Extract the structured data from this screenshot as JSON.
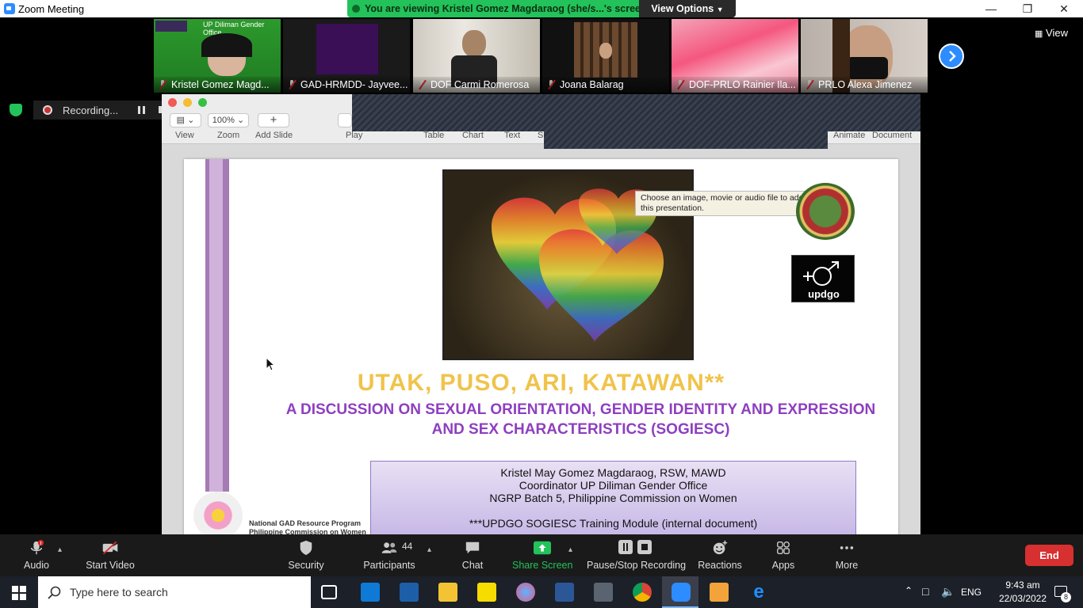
{
  "window": {
    "title": "Zoom Meeting"
  },
  "banner": {
    "viewing_text": "You are viewing Kristel Gomez Magdaraog (she/s...'s screen",
    "view_options": "View Options"
  },
  "participants": [
    {
      "name": "Kristel Gomez Magd..."
    },
    {
      "name": "GAD-HRMDD- Jayvee..."
    },
    {
      "name": "DOF Carmi Romerosa"
    },
    {
      "name": "Joana Balarag"
    },
    {
      "name": "DOF-PRLO Rainier Ila..."
    },
    {
      "name": "PRLO Alexa Jimenez"
    }
  ],
  "gallery": {
    "view_label": "View",
    "tile1_caption": "UP Diliman Gender Office"
  },
  "recording": {
    "label": "Recording..."
  },
  "keynote": {
    "zoom_value": "100%",
    "labels": [
      "View",
      "Zoom",
      "Add Slide",
      "Play",
      "Table",
      "Chart",
      "Text",
      "S",
      "Animate",
      "Document"
    ]
  },
  "slide": {
    "tooltip": "Choose an image, movie or audio file to add to this presentation.",
    "title": "UTAK, PUSO, ARI, KATAWAN**",
    "subtitle_line1": "A DISCUSSION ON SEXUAL ORIENTATION, GENDER IDENTITY AND EXPRESSION",
    "subtitle_line2": "AND SEX CHARACTERISTICS (SOGIESC)",
    "credits": [
      "Kristel May Gomez Magdaraog, RSW,  MAWD",
      "Coordinator  UP  Diliman  Gender  Office",
      "NGRP Batch 5, Philippine Commission on Women",
      "***UPDGO SOGIESC Training Module (internal document)"
    ],
    "updgo_logo_text": "updgo",
    "ngrp_line1": "National GAD Resource Program",
    "ngrp_line2": "Philippine Commission on Women"
  },
  "controls": {
    "audio": "Audio",
    "start_video": "Start Video",
    "security": "Security",
    "participants": "Participants",
    "participants_count": "44",
    "chat": "Chat",
    "share_screen": "Share Screen",
    "pause_stop_recording": "Pause/Stop Recording",
    "reactions": "Reactions",
    "apps": "Apps",
    "more": "More",
    "end": "End"
  },
  "taskbar": {
    "search_placeholder": "Type here to search",
    "language": "ENG",
    "time": "9:43 am",
    "date": "22/03/2022",
    "notifications": "8"
  },
  "colors": {
    "zoom_blue": "#2d8cff",
    "banner_green": "#23c25a",
    "end_red": "#d73030",
    "slide_title": "#f0c34b",
    "slide_purple": "#8e3fbf"
  }
}
